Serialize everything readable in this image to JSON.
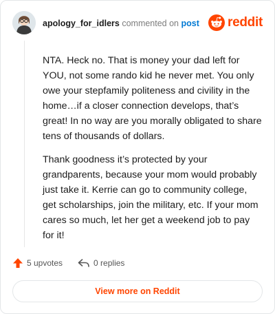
{
  "comment": {
    "username": "apology_for_idlers",
    "action": "commented on",
    "post_link": "post",
    "paragraphs": [
      "NTA. Heck no. That is money your dad left for YOU, not some rando kid he never met. You only owe your stepfamily politeness and civility in the home…if a closer connection develops, that’s great! In no way are you morally obligated to share tens of thousands of dollars.",
      "Thank goodness it’s protected by your grandparents, because your mom would probably just take it. Kerrie can go to community college, get scholarships, join the military, etc. If your mom cares so much, let her get a weekend job to pay for it!"
    ]
  },
  "brand": {
    "wordmark": "reddit",
    "icon": "reddit-snoo-icon",
    "color": "#ff4500"
  },
  "footer": {
    "upvotes_label": "5 upvotes",
    "replies_label": "0 replies",
    "upvote_icon": "upvote-arrow-icon",
    "reply_icon": "reply-arrow-icon",
    "upvote_color": "#ff4500"
  },
  "cta": {
    "label": "View more on Reddit"
  }
}
